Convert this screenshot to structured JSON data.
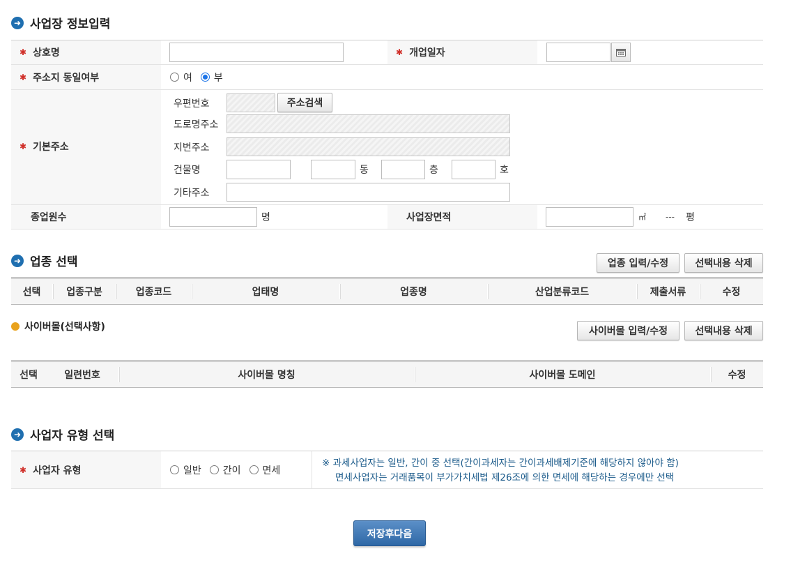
{
  "section1": {
    "title": "사업장 정보입력",
    "fields": {
      "company_name": "상호명",
      "open_date": "개업일자",
      "same_address": "주소지 동일여부",
      "base_address": "기본주소",
      "employees": "종업원수",
      "area": "사업장면적"
    },
    "radio_yes": "여",
    "radio_no": "부",
    "address": {
      "postal_label": "우편번호",
      "search_button": "주소검색",
      "road_label": "도로명주소",
      "lot_label": "지번주소",
      "building_label": "건물명",
      "dong": "동",
      "floor": "층",
      "ho": "호",
      "etc_label": "기타주소"
    },
    "employees_unit": "명",
    "area_unit": "㎡",
    "pyeong_value": "---",
    "pyeong_unit": "평"
  },
  "section2": {
    "title": "업종 선택",
    "edit_button": "업종 입력/수정",
    "delete_button": "선택내용 삭제",
    "columns": [
      "선택",
      "업종구분",
      "업종코드",
      "업태명",
      "업종명",
      "산업분류코드",
      "제출서류",
      "수정"
    ]
  },
  "cyber": {
    "title": "사이버몰(선택사항)",
    "edit_button": "사이버몰 입력/수정",
    "delete_button": "선택내용 삭제",
    "columns": [
      "선택",
      "일련번호",
      "사이버몰 명칭",
      "사이버몰 도메인",
      "수정"
    ]
  },
  "section3": {
    "title": "사업자 유형 선택",
    "label": "사업자 유형",
    "options": [
      "일반",
      "간이",
      "면세"
    ],
    "note_line1": "※ 과세사업자는 일반, 간이 중 선택(간이과세자는 간이과세배제기준에 해당하지 않아야 함)",
    "note_line2": "면세사업자는 거래품목이 부가가치세법 제26조에 의한 면세에 해당하는 경우에만 선택"
  },
  "submit_button": "저장후다음",
  "colors": {
    "accent": "#1f6fb0",
    "required": "#d0302a",
    "primary_button": "#3a72b0",
    "note": "#1a5a8a"
  }
}
